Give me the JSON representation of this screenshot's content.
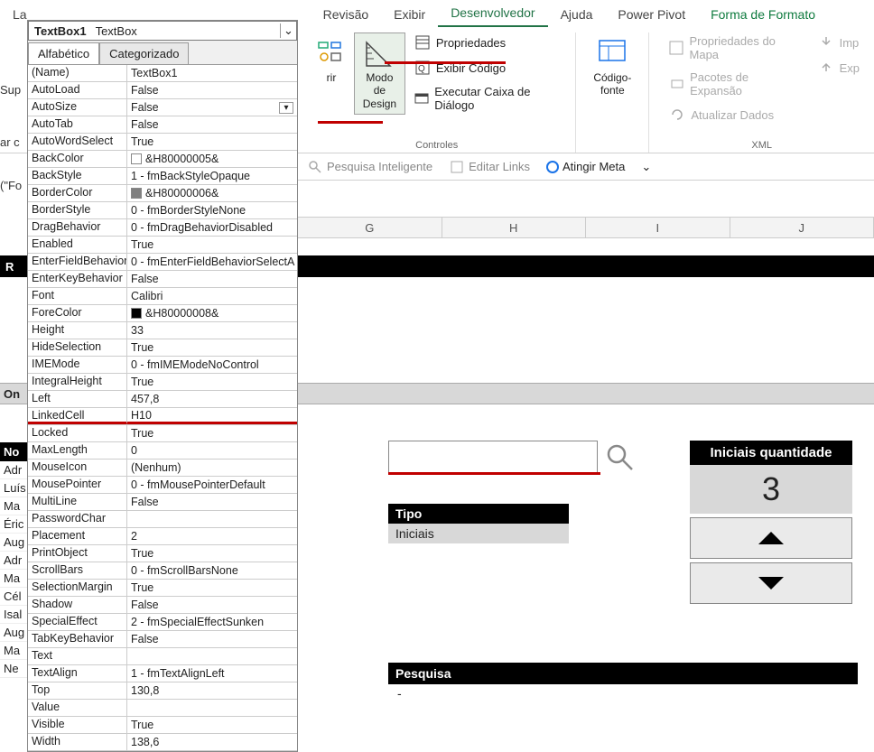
{
  "ribbon": {
    "tabs": [
      "La",
      "Revisão",
      "Exibir",
      "Desenvolvedor",
      "Ajuda",
      "Power Pivot",
      "Forma de Formato"
    ],
    "active_index": 3,
    "groups": {
      "controles": {
        "label": "Controles",
        "design_mode": "Modo de\nDesign",
        "insert_suffix": "rir",
        "propriedades": "Propriedades",
        "exibir_codigo": "Exibir Código",
        "executar_caixa": "Executar Caixa de Diálogo"
      },
      "codigo_fonte": {
        "label": "Código-fonte"
      },
      "xml": {
        "label": "XML",
        "propriedades_mapa": "Propriedades do Mapa",
        "pacotes_expansao": "Pacotes de Expansão",
        "atualizar_dados": "Atualizar Dados",
        "imp": "Imp",
        "exp": "Exp"
      }
    },
    "secondary": {
      "pesquisa": "Pesquisa Inteligente",
      "editar_links": "Editar Links",
      "atingir_meta": "Atingir Meta"
    }
  },
  "left_edge": {
    "sup": "Sup",
    "ar": "ar c",
    "f": "(\"Fo",
    "r": "R",
    "on": "On",
    "no": "No"
  },
  "props": {
    "object_name": "TextBox1",
    "object_type": "TextBox",
    "tabs": {
      "alfa": "Alfabético",
      "cat": "Categorizado"
    },
    "rows": [
      {
        "name": "(Name)",
        "value": "TextBox1"
      },
      {
        "name": "AutoLoad",
        "value": "False"
      },
      {
        "name": "AutoSize",
        "value": "False",
        "dropdown": true
      },
      {
        "name": "AutoTab",
        "value": "False"
      },
      {
        "name": "AutoWordSelect",
        "value": "True"
      },
      {
        "name": "BackColor",
        "value": "&H80000005&",
        "swatch": "#ffffff"
      },
      {
        "name": "BackStyle",
        "value": "1 - fmBackStyleOpaque"
      },
      {
        "name": "BorderColor",
        "value": "&H80000006&",
        "swatch": "#808080"
      },
      {
        "name": "BorderStyle",
        "value": "0 - fmBorderStyleNone"
      },
      {
        "name": "DragBehavior",
        "value": "0 - fmDragBehaviorDisabled"
      },
      {
        "name": "Enabled",
        "value": "True"
      },
      {
        "name": "EnterFieldBehavior",
        "value": "0 - fmEnterFieldBehaviorSelectA"
      },
      {
        "name": "EnterKeyBehavior",
        "value": "False"
      },
      {
        "name": "Font",
        "value": "Calibri"
      },
      {
        "name": "ForeColor",
        "value": "&H80000008&",
        "swatch": "#000000"
      },
      {
        "name": "Height",
        "value": "33"
      },
      {
        "name": "HideSelection",
        "value": "True"
      },
      {
        "name": "IMEMode",
        "value": "0 - fmIMEModeNoControl"
      },
      {
        "name": "IntegralHeight",
        "value": "True"
      },
      {
        "name": "Left",
        "value": "457,8"
      },
      {
        "name": "LinkedCell",
        "value": "H10",
        "highlight": true
      },
      {
        "name": "Locked",
        "value": "True"
      },
      {
        "name": "MaxLength",
        "value": "0"
      },
      {
        "name": "MouseIcon",
        "value": "(Nenhum)"
      },
      {
        "name": "MousePointer",
        "value": "0 - fmMousePointerDefault"
      },
      {
        "name": "MultiLine",
        "value": "False"
      },
      {
        "name": "PasswordChar",
        "value": ""
      },
      {
        "name": "Placement",
        "value": "2"
      },
      {
        "name": "PrintObject",
        "value": "True"
      },
      {
        "name": "ScrollBars",
        "value": "0 - fmScrollBarsNone"
      },
      {
        "name": "SelectionMargin",
        "value": "True"
      },
      {
        "name": "Shadow",
        "value": "False"
      },
      {
        "name": "SpecialEffect",
        "value": "2 - fmSpecialEffectSunken"
      },
      {
        "name": "TabKeyBehavior",
        "value": "False"
      },
      {
        "name": "Text",
        "value": ""
      },
      {
        "name": "TextAlign",
        "value": "1 - fmTextAlignLeft"
      },
      {
        "name": "Top",
        "value": "130,8"
      },
      {
        "name": "Value",
        "value": ""
      },
      {
        "name": "Visible",
        "value": "True"
      },
      {
        "name": "Width",
        "value": "138,6"
      }
    ]
  },
  "columns": [
    "G",
    "H",
    "I",
    "J"
  ],
  "names": [
    "Adr",
    "Luís",
    "Ma",
    "Éric",
    "Aug",
    "Adr",
    "Ma",
    "Cél",
    "Isal",
    "Aug",
    "Ma",
    "Ne"
  ],
  "search": {
    "value": ""
  },
  "tipo": {
    "header": "Tipo",
    "value": "Iniciais"
  },
  "iniciais": {
    "header": "Iniciais quantidade",
    "value": "3"
  },
  "pesquisa": {
    "header": "Pesquisa",
    "value": "-"
  }
}
